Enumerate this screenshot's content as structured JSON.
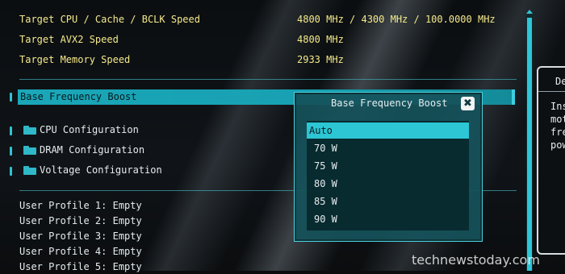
{
  "targets": [
    {
      "label": "Target CPU / Cache / BCLK Speed",
      "value": "4800 MHz / 4300 MHz / 100.0000 MHz"
    },
    {
      "label": "Target AVX2 Speed",
      "value": "4800 MHz"
    },
    {
      "label": "Target Memory Speed",
      "value": "2933 MHz"
    }
  ],
  "selected_item": {
    "label": "Base Frequency Boost"
  },
  "folders": [
    {
      "label": "CPU Configuration"
    },
    {
      "label": "DRAM Configuration"
    },
    {
      "label": "Voltage Configuration"
    }
  ],
  "profiles": [
    "User Profile 1: Empty",
    "User Profile 2: Empty",
    "User Profile 3: Empty",
    "User Profile 4: Empty",
    "User Profile 5: Empty"
  ],
  "popup": {
    "title": "Base Frequency Boost",
    "close_glyph": "✖",
    "options": [
      "Auto",
      "70 W",
      "75 W",
      "80 W",
      "85 W",
      "90 W"
    ],
    "selected": "Auto"
  },
  "description": {
    "title": "De",
    "lines": [
      "Ins",
      "mot",
      "fre",
      "pow"
    ]
  },
  "watermark": "technewstoday.com",
  "colors": {
    "accent": "#2cc6d4",
    "target_text": "#f4e98a",
    "popup_bg": "#16525a"
  }
}
